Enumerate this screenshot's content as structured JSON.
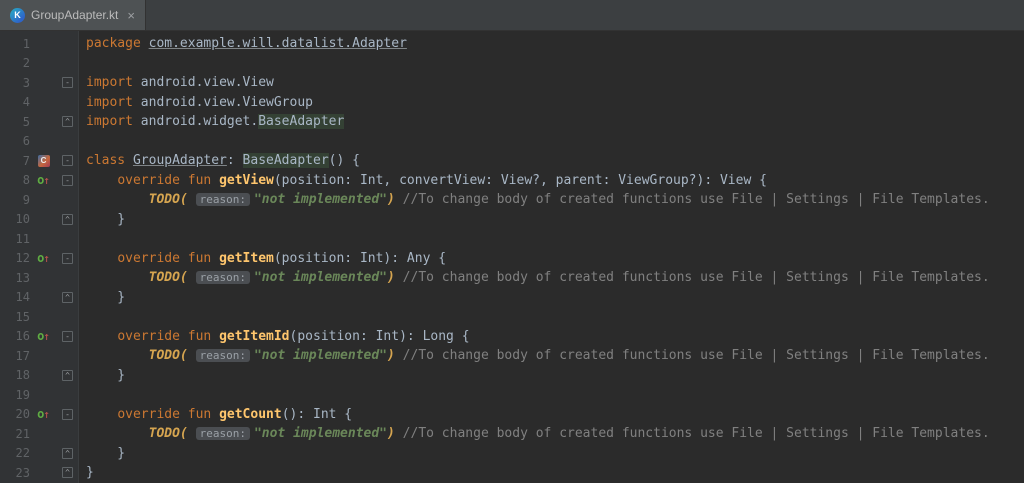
{
  "tab": {
    "title": "GroupAdapter.kt"
  },
  "icons": {
    "kotlin_glyph": "K",
    "close_glyph": "×",
    "class_glyph": "C",
    "override_o_glyph": "o",
    "override_arrow_glyph": "↑",
    "fold_start_glyph": "-",
    "fold_end_glyph": "^"
  },
  "colors": {
    "editor_bg": "#2B2B2B",
    "gutter_bg": "#313335",
    "tabbar_bg": "#3C3F41",
    "active_tab_bg": "#4E5254",
    "keyword": "#CC7832",
    "function_name": "#FFC66D",
    "string": "#6A8759",
    "comment": "#808080",
    "default_text": "#A9B7C6",
    "line_number": "#606366",
    "identifier_highlight_bg": "#344134"
  },
  "editor": {
    "lines": [
      {
        "num": "1",
        "icon": null,
        "fold": null,
        "seg": [
          {
            "c": "kw",
            "t": "package "
          },
          {
            "c": "u",
            "t": "com.example.will.datalist.Adapter"
          }
        ]
      },
      {
        "num": "2",
        "icon": null,
        "fold": null,
        "seg": []
      },
      {
        "num": "3",
        "icon": null,
        "fold": "start",
        "seg": [
          {
            "c": "kw",
            "t": "import "
          },
          {
            "c": "def",
            "t": "android.view.View"
          }
        ]
      },
      {
        "num": "4",
        "icon": null,
        "fold": null,
        "seg": [
          {
            "c": "kw",
            "t": "import "
          },
          {
            "c": "def",
            "t": "android.view.ViewGroup"
          }
        ]
      },
      {
        "num": "5",
        "icon": null,
        "fold": "end",
        "seg": [
          {
            "c": "kw",
            "t": "import "
          },
          {
            "c": "def",
            "t": "android.widget."
          },
          {
            "c": "hl",
            "t": "BaseAdapter"
          }
        ]
      },
      {
        "num": "6",
        "icon": null,
        "fold": null,
        "seg": []
      },
      {
        "num": "7",
        "icon": "class",
        "fold": "start",
        "seg": [
          {
            "c": "kw",
            "t": "class "
          },
          {
            "c": "u",
            "t": "GroupAdapter"
          },
          {
            "c": "def",
            "t": ": "
          },
          {
            "c": "hl",
            "t": "BaseAdapter"
          },
          {
            "c": "def",
            "t": "() {"
          }
        ]
      },
      {
        "num": "8",
        "icon": "override",
        "fold": "start",
        "seg": [
          {
            "c": "def",
            "t": "    "
          },
          {
            "c": "kw",
            "t": "override fun "
          },
          {
            "c": "fn",
            "t": "getView"
          },
          {
            "c": "def",
            "t": "(position: Int, convertView: View?, parent: ViewGroup?): View {"
          }
        ]
      },
      {
        "num": "9",
        "icon": null,
        "fold": null,
        "seg": [
          {
            "c": "def",
            "t": "        "
          },
          {
            "c": "todo",
            "t": "TODO( "
          },
          {
            "c": "hint",
            "t": "reason:"
          },
          {
            "c": "str",
            "t": "\"not implemented\""
          },
          {
            "c": "todo",
            "t": ") "
          },
          {
            "c": "cm",
            "t": "//To change body of created functions use File | Settings | File Templates."
          }
        ]
      },
      {
        "num": "10",
        "icon": null,
        "fold": "end",
        "seg": [
          {
            "c": "def",
            "t": "    }"
          }
        ]
      },
      {
        "num": "11",
        "icon": null,
        "fold": null,
        "seg": []
      },
      {
        "num": "12",
        "icon": "override",
        "fold": "start",
        "seg": [
          {
            "c": "def",
            "t": "    "
          },
          {
            "c": "kw",
            "t": "override fun "
          },
          {
            "c": "fn",
            "t": "getItem"
          },
          {
            "c": "def",
            "t": "(position: Int): Any {"
          }
        ]
      },
      {
        "num": "13",
        "icon": null,
        "fold": null,
        "seg": [
          {
            "c": "def",
            "t": "        "
          },
          {
            "c": "todo",
            "t": "TODO( "
          },
          {
            "c": "hint",
            "t": "reason:"
          },
          {
            "c": "str",
            "t": "\"not implemented\""
          },
          {
            "c": "todo",
            "t": ") "
          },
          {
            "c": "cm",
            "t": "//To change body of created functions use File | Settings | File Templates."
          }
        ]
      },
      {
        "num": "14",
        "icon": null,
        "fold": "end",
        "seg": [
          {
            "c": "def",
            "t": "    }"
          }
        ]
      },
      {
        "num": "15",
        "icon": null,
        "fold": null,
        "seg": []
      },
      {
        "num": "16",
        "icon": "override",
        "fold": "start",
        "seg": [
          {
            "c": "def",
            "t": "    "
          },
          {
            "c": "kw",
            "t": "override fun "
          },
          {
            "c": "fn",
            "t": "getItemId"
          },
          {
            "c": "def",
            "t": "(position: Int): Long {"
          }
        ]
      },
      {
        "num": "17",
        "icon": null,
        "fold": null,
        "seg": [
          {
            "c": "def",
            "t": "        "
          },
          {
            "c": "todo",
            "t": "TODO( "
          },
          {
            "c": "hint",
            "t": "reason:"
          },
          {
            "c": "str",
            "t": "\"not implemented\""
          },
          {
            "c": "todo",
            "t": ") "
          },
          {
            "c": "cm",
            "t": "//To change body of created functions use File | Settings | File Templates."
          }
        ]
      },
      {
        "num": "18",
        "icon": null,
        "fold": "end",
        "seg": [
          {
            "c": "def",
            "t": "    }"
          }
        ]
      },
      {
        "num": "19",
        "icon": null,
        "fold": null,
        "seg": []
      },
      {
        "num": "20",
        "icon": "override",
        "fold": "start",
        "seg": [
          {
            "c": "def",
            "t": "    "
          },
          {
            "c": "kw",
            "t": "override fun "
          },
          {
            "c": "fn",
            "t": "getCount"
          },
          {
            "c": "def",
            "t": "(): Int {"
          }
        ]
      },
      {
        "num": "21",
        "icon": null,
        "fold": null,
        "seg": [
          {
            "c": "def",
            "t": "        "
          },
          {
            "c": "todo",
            "t": "TODO( "
          },
          {
            "c": "hint",
            "t": "reason:"
          },
          {
            "c": "str",
            "t": "\"not implemented\""
          },
          {
            "c": "todo",
            "t": ") "
          },
          {
            "c": "cm",
            "t": "//To change body of created functions use File | Settings | File Templates."
          }
        ]
      },
      {
        "num": "22",
        "icon": null,
        "fold": "end",
        "seg": [
          {
            "c": "def",
            "t": "    }"
          }
        ]
      },
      {
        "num": "23",
        "icon": null,
        "fold": "end",
        "seg": [
          {
            "c": "def",
            "t": "}"
          }
        ]
      }
    ]
  }
}
